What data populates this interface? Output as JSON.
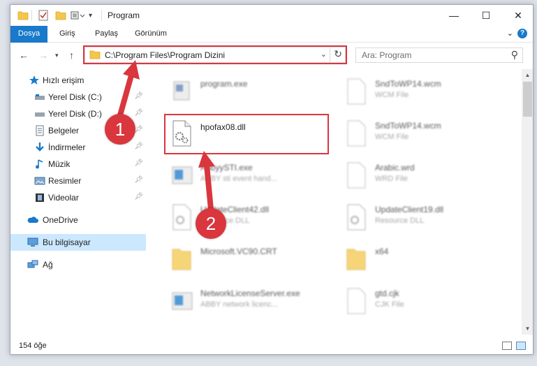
{
  "window": {
    "title": "Program",
    "controls": [
      "—",
      "☐",
      "✕"
    ]
  },
  "ribbon": {
    "tabs": [
      "Dosya",
      "Giriş",
      "Paylaş",
      "Görünüm"
    ],
    "expand": "⌄",
    "help": "?"
  },
  "address": {
    "path": "C:\\Program Files\\Program Dizini",
    "search_placeholder": "Ara: Program"
  },
  "sidebar": {
    "items": [
      {
        "label": "Hızlı erişim",
        "icon": "star-icon"
      },
      {
        "label": "Yerel Disk (C:)",
        "icon": "drive-icon",
        "pinned": true
      },
      {
        "label": "Yerel Disk (D:)",
        "icon": "drive-icon",
        "pinned": true
      },
      {
        "label": "Belgeler",
        "icon": "documents-icon",
        "pinned": true
      },
      {
        "label": "İndirmeler",
        "icon": "download-icon",
        "pinned": true
      },
      {
        "label": "Müzik",
        "icon": "music-icon",
        "pinned": true
      },
      {
        "label": "Resimler",
        "icon": "pictures-icon",
        "pinned": true
      },
      {
        "label": "Videolar",
        "icon": "video-icon",
        "pinned": true
      },
      {
        "label": "OneDrive",
        "icon": "cloud-icon"
      },
      {
        "label": "Bu bilgisayar",
        "icon": "computer-icon",
        "selected": true
      },
      {
        "label": "Ağ",
        "icon": "network-icon"
      }
    ]
  },
  "files": {
    "left": [
      {
        "name": "program.exe",
        "type": ""
      },
      {
        "name": "hpofax08.dll",
        "type": ""
      },
      {
        "name": "AbbyySTI.exe",
        "type": "ABBY sti event hand..."
      },
      {
        "name": "UpdateClient42.dll",
        "type": "Resource DLL"
      },
      {
        "name": "Microsoft.VC90.CRT",
        "type": ""
      },
      {
        "name": "NetworkLicenseServer.exe",
        "type": "ABBY network licenc..."
      }
    ],
    "right": [
      {
        "name": "SndToWP14.wcm",
        "type": "WCM File"
      },
      {
        "name": "SndToWP14.wcm",
        "type": "WCM File"
      },
      {
        "name": "Arabic.wrd",
        "type": "WRD File"
      },
      {
        "name": "UpdateClient19.dll",
        "type": "Resource DLL"
      },
      {
        "name": "x64",
        "type": ""
      },
      {
        "name": "gtd.cjk",
        "type": "CJK File"
      }
    ]
  },
  "status": {
    "count": "154 öğe"
  },
  "annotations": {
    "step1": "1",
    "step2": "2",
    "color": "#d9363e"
  }
}
